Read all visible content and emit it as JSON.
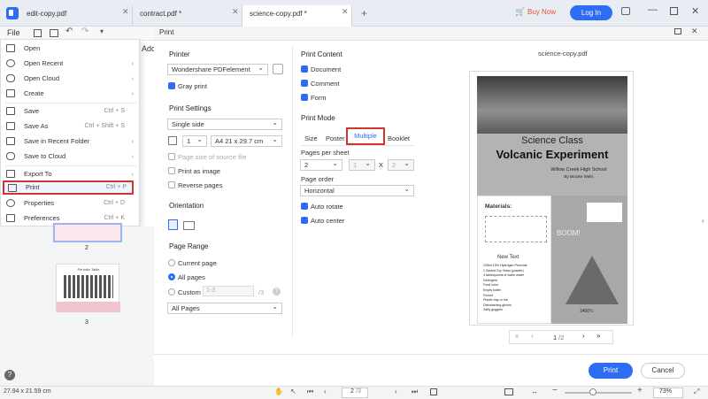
{
  "tabs": [
    {
      "label": "edit-copy.pdf"
    },
    {
      "label": "contract.pdf *"
    },
    {
      "label": "science-copy.pdf *"
    }
  ],
  "header": {
    "buy_now": "Buy Now",
    "login": "Log In"
  },
  "menu_label": "File",
  "file_menu": [
    {
      "label": "Open",
      "shortcut": "",
      "icon": "folder-icon"
    },
    {
      "label": "Open Recent",
      "shortcut": "",
      "arrow": "›",
      "icon": "clock-icon"
    },
    {
      "label": "Open Cloud",
      "shortcut": "",
      "arrow": "›",
      "icon": "cloud-icon"
    },
    {
      "label": "Create",
      "shortcut": "",
      "arrow": "›",
      "icon": "create-icon"
    },
    {
      "label": "Save",
      "shortcut": "Ctrl + S",
      "icon": "save-icon"
    },
    {
      "label": "Save As",
      "shortcut": "Ctrl + Shift + S",
      "icon": "save-as-icon"
    },
    {
      "label": "Save in Recent Folder",
      "shortcut": "",
      "arrow": "›",
      "icon": "folder-icon"
    },
    {
      "label": "Save to Cloud",
      "shortcut": "",
      "arrow": "›",
      "icon": "cloud-icon"
    },
    {
      "label": "Export To",
      "shortcut": "",
      "arrow": "›",
      "icon": "export-icon"
    },
    {
      "label": "Print",
      "shortcut": "Ctrl + P",
      "icon": "printer-icon"
    },
    {
      "label": "Properties",
      "shortcut": "Ctrl + D",
      "icon": "properties-icon"
    },
    {
      "label": "Preferences",
      "shortcut": "Ctrl + K",
      "icon": "preferences-icon"
    }
  ],
  "add_label": "Add",
  "thumbnails": {
    "page2": "2",
    "page3": "3",
    "page3_title": "Periodic Table"
  },
  "dialog": {
    "title": "Print",
    "printer_section": "Printer",
    "printer_name": "Wondershare PDFelement",
    "gray_print": "Gray print",
    "print_settings": "Print Settings",
    "side": "Single side",
    "copies": "1",
    "paper": "A4 21 x 29.7 cm",
    "page_size_source": "Page size of source file",
    "print_as_image": "Print as image",
    "reverse_pages": "Reverse pages",
    "orientation": "Orientation",
    "page_range": "Page Range",
    "current_page": "Current page",
    "all_pages": "All pages",
    "custom": "Custom",
    "custom_value": "1-3",
    "custom_total": "/3",
    "subset": "All Pages",
    "print_content": "Print Content",
    "document": "Document",
    "comment": "Comment",
    "form": "Form",
    "print_mode": "Print Mode",
    "modes": [
      "Size",
      "Poster",
      "Multiple",
      "Booklet"
    ],
    "pages_per_sheet": "Pages per sheet",
    "pps_value": "2",
    "pps_x": "1",
    "pps_y": "2",
    "times": "X",
    "page_order": "Page order",
    "order_value": "Horizontal",
    "auto_rotate": "Auto rotate",
    "auto_center": "Auto center",
    "print_btn": "Print",
    "cancel_btn": "Cancel"
  },
  "preview": {
    "filename": "science-copy.pdf",
    "heading1": "Science Class",
    "heading2": "Volcanic Experiment",
    "school": "Willow Creek High School",
    "author": "By Brooke Wells",
    "materials": "Materials:",
    "new_text": "New Text",
    "list": [
      "125ml 10% Hydrogen Peroxide",
      "1 Sachet Dry Yeast (powder)",
      "4 tablespoons of warm water",
      "Detergent",
      "Food color",
      "Empty bottle",
      "Funnel",
      "Plastic tray or tub",
      "Dishwashing gloves",
      "Safty goggles"
    ],
    "boom": "BOOM!",
    "temp": "1400°c",
    "page": "1",
    "total": "/2"
  },
  "status": {
    "size": "27.94 x 21.59 cm",
    "page": "2",
    "pages": "/3",
    "zoom": "73%"
  }
}
